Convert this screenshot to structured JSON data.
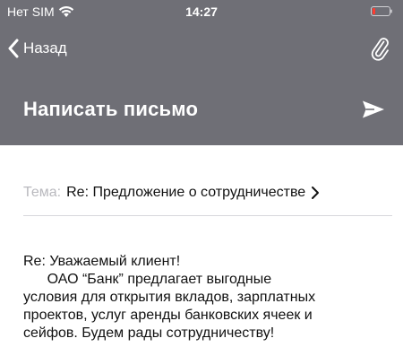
{
  "status_bar": {
    "carrier": "Нет SIM",
    "time": "14:27",
    "battery_color": "#ff3b30"
  },
  "nav": {
    "back_label": "Назад",
    "back_icon": "chevron-left-icon",
    "attach_icon": "paperclip-icon"
  },
  "title": {
    "text": "Написать письмо",
    "send_icon": "send-icon"
  },
  "subject": {
    "label": "Тема:",
    "value": "Re: Предложение о сотрудничестве",
    "chevron_icon": "chevron-right-icon"
  },
  "message": {
    "lines": [
      "Re: Уважаемый клиент!",
      "      ОАО “Банк” предлагает выгодные",
      "условия для открытия вкладов, зарплатных",
      "проектов, услуг аренды банковских ячеек и",
      "сейфов. Будем рады сотрудничеству!"
    ]
  },
  "colors": {
    "header_bg": "#6f6f76",
    "header_text": "#ffffff",
    "subject_label": "#b9b9be",
    "divider": "#d8d8dc"
  }
}
